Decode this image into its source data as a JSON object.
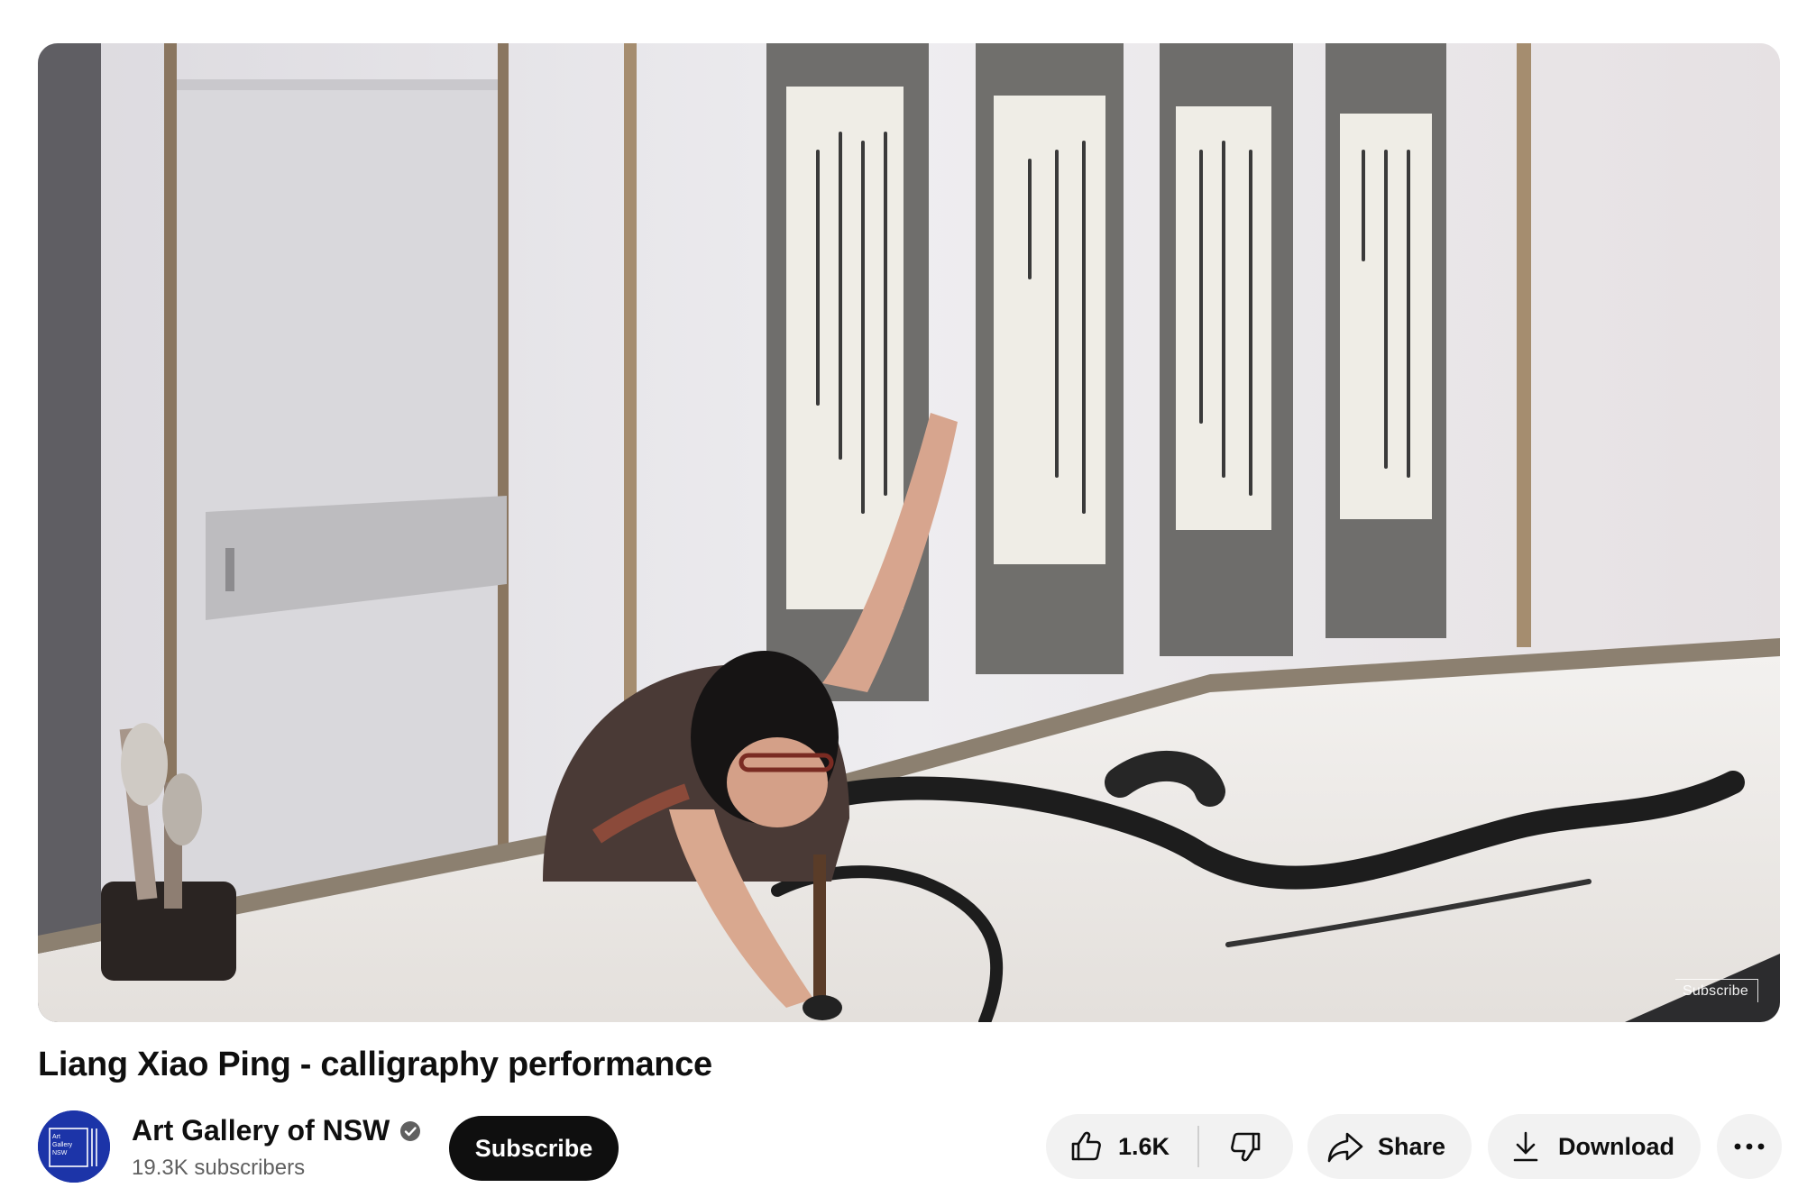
{
  "video": {
    "title": "Liang Xiao Ping - calligraphy performance",
    "watermark_label": "Subscribe"
  },
  "channel": {
    "name": "Art Gallery of NSW",
    "subscribers": "19.3K subscribers",
    "avatar_text": [
      "Art",
      "Gallery",
      "NSW"
    ],
    "verified_icon": "verified-check-icon",
    "avatar_color": "#1c34a8"
  },
  "actions": {
    "subscribe_label": "Subscribe",
    "like_count": "1.6K",
    "share_label": "Share",
    "download_label": "Download",
    "icons": {
      "like": "thumb-up-icon",
      "dislike": "thumb-down-icon",
      "share": "share-arrow-icon",
      "download": "download-icon",
      "more": "more-horizontal-icon"
    }
  },
  "colors": {
    "subscribe_bg": "#0f0f0f",
    "pill_bg": "#f2f2f2",
    "secondary_text": "#606060"
  }
}
